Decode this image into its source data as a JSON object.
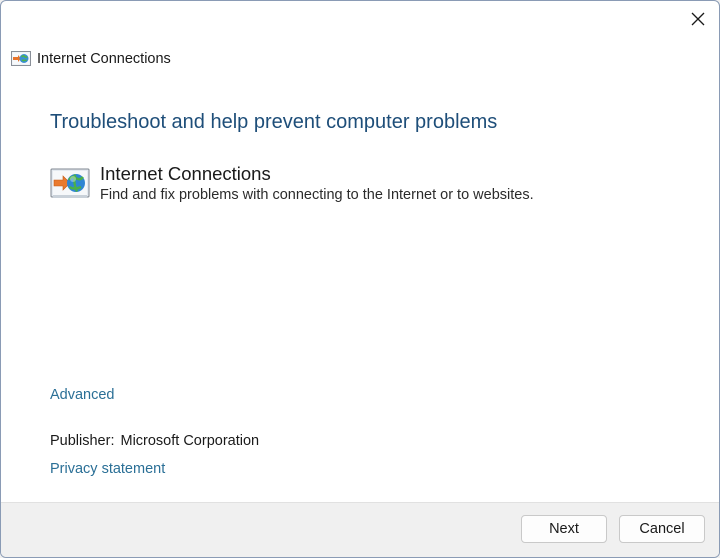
{
  "window": {
    "title": "Internet Connections",
    "close_icon": "close-icon"
  },
  "main": {
    "heading": "Troubleshoot and help prevent computer problems",
    "troubleshooter": {
      "title": "Internet Connections",
      "description": "Find and fix problems with connecting to the Internet or to websites.",
      "icon": "internet-connections-icon"
    },
    "advanced_link": "Advanced",
    "publisher_label": "Publisher:",
    "publisher_value": "Microsoft Corporation",
    "privacy_link": "Privacy statement"
  },
  "footer": {
    "next_label": "Next",
    "cancel_label": "Cancel"
  },
  "colors": {
    "heading": "#1e4e79",
    "link": "#2a6f96",
    "footer_bg": "#f0f0f0"
  }
}
